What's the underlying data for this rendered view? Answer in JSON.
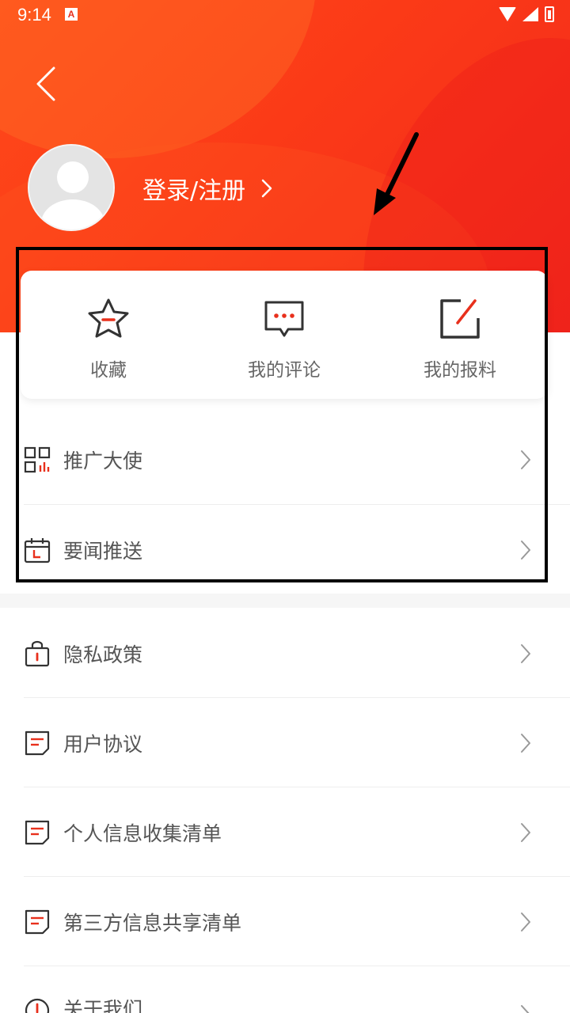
{
  "status_bar": {
    "time": "9:14",
    "app_badge": "A"
  },
  "profile": {
    "login_text": "登录/注册"
  },
  "quick_actions": [
    {
      "label": "收藏",
      "icon": "star-icon"
    },
    {
      "label": "我的评论",
      "icon": "comment-icon"
    },
    {
      "label": "我的报料",
      "icon": "edit-icon"
    }
  ],
  "menu_group_1": [
    {
      "label": "推广大使",
      "icon": "qr-chart-icon"
    },
    {
      "label": "要闻推送",
      "icon": "calendar-icon"
    }
  ],
  "menu_group_2": [
    {
      "label": "隐私政策",
      "icon": "lock-icon"
    },
    {
      "label": "用户协议",
      "icon": "document-icon"
    },
    {
      "label": "个人信息收集清单",
      "icon": "document-icon"
    },
    {
      "label": "第三方信息共享清单",
      "icon": "document-icon"
    },
    {
      "label": "关于我们",
      "icon": "info-icon"
    }
  ],
  "colors": {
    "accent": "#e8301c",
    "header_start": "#ff4a1a",
    "header_end": "#f2281c"
  }
}
